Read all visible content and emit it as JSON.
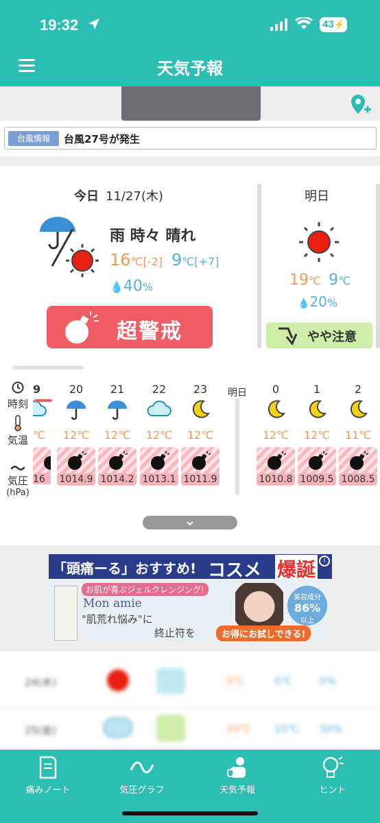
{
  "status_bar": {
    "time": "19:32",
    "battery": "43"
  },
  "nav": {
    "title": "天気予報"
  },
  "notice": {
    "tag": "台風情報",
    "message": "台風27号が発生"
  },
  "today": {
    "label": "今日",
    "date": "11/27(木)",
    "condition": "雨 時々 晴れ",
    "high": "16",
    "high_diff": "℃[-2]",
    "low": "9",
    "low_diff": "℃[+7]",
    "rain": "40",
    "rain_unit": "%",
    "alert": "超警戒"
  },
  "tomorrow": {
    "label": "明日",
    "high": "19",
    "low": "9",
    "unit": "℃",
    "rain": "20",
    "rain_unit": "%",
    "alert": "やや注意"
  },
  "hourly": {
    "row_labels": {
      "time": "時刻",
      "temp": "気温",
      "pressure": "気圧",
      "pressure_unit": "(hPa)"
    },
    "tomorrow_label": "明日",
    "hours": [
      {
        "hour": "9",
        "icon": "cloud-icon",
        "temp": "℃",
        "pressure": "16"
      },
      {
        "hour": "20",
        "icon": "umbrella-icon",
        "temp": "12℃",
        "pressure": "1014.9"
      },
      {
        "hour": "21",
        "icon": "umbrella-icon",
        "temp": "12℃",
        "pressure": "1014.2"
      },
      {
        "hour": "22",
        "icon": "cloud-icon",
        "temp": "12℃",
        "pressure": "1013.1"
      },
      {
        "hour": "23",
        "icon": "moon-icon",
        "temp": "12℃",
        "pressure": "1011.9"
      },
      {
        "hour": "0",
        "icon": "moon-icon",
        "temp": "12℃",
        "pressure": "1010.8"
      },
      {
        "hour": "1",
        "icon": "moon-icon",
        "temp": "12℃",
        "pressure": "1009.5"
      },
      {
        "hour": "2",
        "icon": "moon-icon",
        "temp": "11℃",
        "pressure": "1008.5"
      }
    ]
  },
  "ad": {
    "headline": "「頭痛ーる」おすすめ!",
    "cosme": "コスメ",
    "burst": "爆誕",
    "tagline": "お肌が喜ぶジェルクレンジング!",
    "brand": "Mon amie",
    "copy1": "\"肌荒れ悩み\"に",
    "copy2": "終止符を",
    "badge_top": "美容成分",
    "badge_value": "86%",
    "badge_bottom": "以上",
    "cta": "お得にお試しできる!"
  },
  "weekly_blurred": [
    {
      "date": "24(木)",
      "high": "0℃",
      "low": "0℃",
      "rain": "0%"
    },
    {
      "date": "25(金)",
      "high": "20℃",
      "low": "10℃",
      "rain": "50%"
    }
  ],
  "tabs": [
    {
      "label": "痛みノート",
      "icon": "notebook-icon"
    },
    {
      "label": "気圧グラフ",
      "icon": "wave-icon"
    },
    {
      "label": "天気予報",
      "icon": "weather-person-icon"
    },
    {
      "label": "ヒント",
      "icon": "lightbulb-icon"
    }
  ],
  "colors": {
    "teal": "#2bbfb4",
    "alert_red": "#f25c65",
    "caution_green": "#cfeeaa",
    "high_temp": "#f2995b",
    "low_temp": "#5aaee0"
  }
}
